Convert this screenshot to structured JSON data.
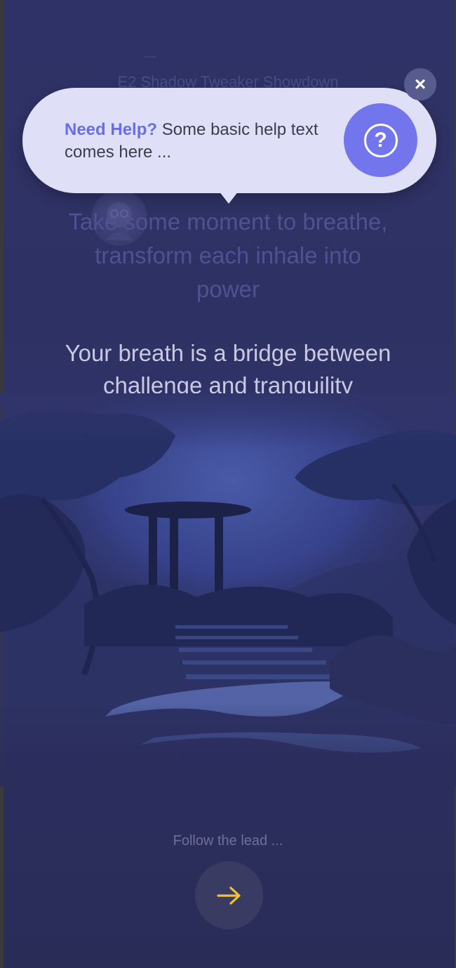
{
  "background": {
    "faded_title": "E2 Shadow Tweaker Showdown",
    "faded_quote": "Take some moment to breathe, transform each inhale into power"
  },
  "main": {
    "quote": "Your breath is a bridge between challenge and tranquility"
  },
  "footer": {
    "follow_text": "Follow the lead ...",
    "next_icon": "arrow-right-icon"
  },
  "tooltip": {
    "highlight": "Need Help?",
    "body": " Some basic help text comes here ...",
    "help_icon": "question-icon",
    "help_symbol": "?",
    "close_symbol": "×"
  },
  "colors": {
    "background": "#2e3163",
    "tooltip_bg": "#dfe0f7",
    "accent": "#7275ec",
    "highlight_text": "#6a6ee6",
    "arrow": "#f2c230"
  }
}
